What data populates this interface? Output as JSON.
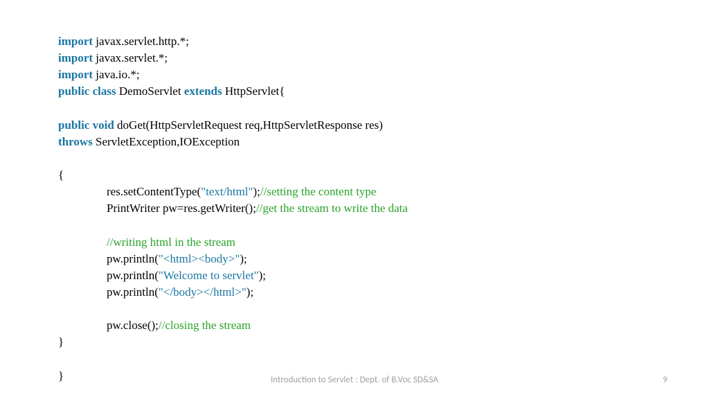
{
  "code": {
    "l1_kw": "import",
    "l1_rest": " javax.servlet.http.*;",
    "l2_kw": "import",
    "l2_rest": " javax.servlet.*;",
    "l3_kw": "import",
    "l3_rest": " java.io.*;",
    "l4_kw1": "public class",
    "l4_mid": " DemoServlet ",
    "l4_kw2": "extends",
    "l4_rest": " HttpServlet{",
    "l6_kw": "public void",
    "l6_rest": " doGet(HttpServletRequest req,HttpServletResponse res)",
    "l7_kw": "throws",
    "l7_rest": " ServletException,IOException",
    "l9": "{",
    "l10_a": "res.setContentType(",
    "l10_b": "\"text/html\"",
    "l10_c": ");",
    "l10_d": "//setting the content type",
    "l11_a": "PrintWriter pw=res.getWriter();",
    "l11_b": "//get the stream to write the data",
    "l13": "//writing html in the stream",
    "l14_a": "pw.println(",
    "l14_b": "\"<html><body>\"",
    "l14_c": ");",
    "l15_a": "pw.println(",
    "l15_b": "\"Welcome to servlet\"",
    "l15_c": ");",
    "l16_a": "pw.println(",
    "l16_b": "\"</body></html>\"",
    "l16_c": ");",
    "l18_a": "pw.close();",
    "l18_b": "//closing the stream",
    "l19": "}",
    "l21": "}"
  },
  "footer": "Introduction to Servlet : Dept. of B.Voc SD&SA",
  "page": "9"
}
